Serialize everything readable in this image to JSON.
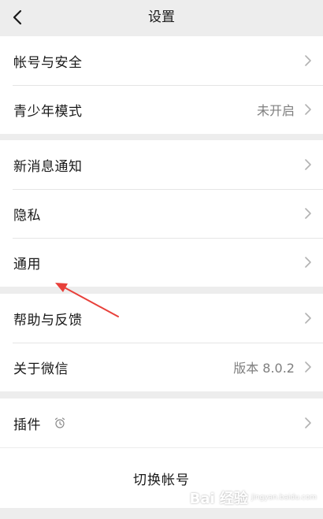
{
  "nav": {
    "title": "设置",
    "back_icon": "chevron-left-icon"
  },
  "groups": [
    {
      "items": [
        {
          "label": "帐号与安全",
          "value": ""
        },
        {
          "label": "青少年模式",
          "value": "未开启"
        }
      ]
    },
    {
      "items": [
        {
          "label": "新消息通知",
          "value": ""
        },
        {
          "label": "隐私",
          "value": ""
        },
        {
          "label": "通用",
          "value": ""
        }
      ]
    },
    {
      "items": [
        {
          "label": "帮助与反馈",
          "value": ""
        },
        {
          "label": "关于微信",
          "value": "版本 8.0.2"
        }
      ]
    },
    {
      "items": [
        {
          "label": "插件",
          "value": "",
          "icon": "alarm-clock-icon"
        }
      ]
    }
  ],
  "actions": {
    "switch_account": "切换帐号"
  },
  "annotation": {
    "arrow_color": "#e8403a"
  },
  "watermark": {
    "brand": "Bai 经验",
    "sub": "jingyan.baidu.com"
  },
  "colors": {
    "background": "#ededed",
    "cell": "#ffffff",
    "text": "#191919",
    "secondary_text": "#7f7f7f",
    "chevron": "#b2b2b2"
  }
}
